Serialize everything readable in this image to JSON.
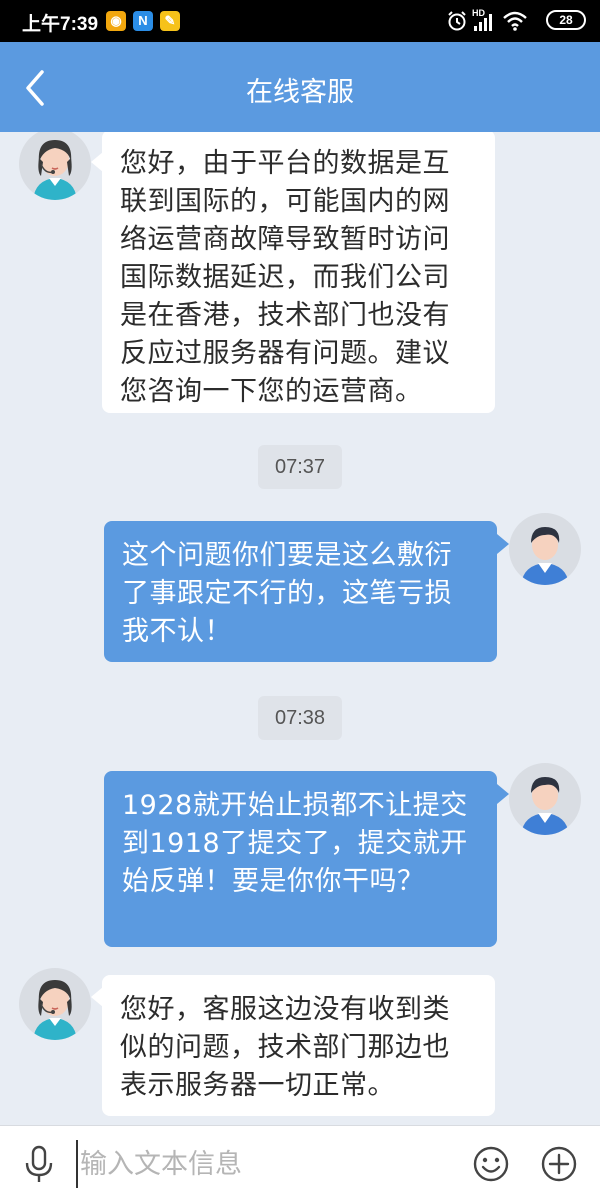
{
  "status_bar": {
    "time": "上午7:39",
    "network": "HD",
    "battery": "28"
  },
  "header": {
    "title": "在线客服"
  },
  "messages": [
    {
      "sender": "agent",
      "text": "您好，由于平台的数据是互联到国际的，可能国内的网络运营商故障导致暂时访问国际数据延迟，而我们公司是在香港，技术部门也没有反应过服务器有问题。建议您咨询一下您的运营商。"
    },
    {
      "type": "timestamp",
      "text": "07:37"
    },
    {
      "sender": "user",
      "text": "这个问题你们要是这么敷衍了事跟定不行的，这笔亏损我不认！"
    },
    {
      "type": "timestamp",
      "text": "07:38"
    },
    {
      "sender": "user",
      "text": "1928就开始止损都不让提交到1918了提交了，提交就开始反弹！要是你你干吗？"
    },
    {
      "sender": "agent",
      "text": "您好，客服这边没有收到类似的问题，技术部门那边也表示服务器一切正常。"
    }
  ],
  "input": {
    "placeholder": "输入文本信息",
    "value": ""
  },
  "icons": {
    "back": "chevron-left-icon",
    "mic": "microphone-icon",
    "emoji": "smiley-icon",
    "plus": "plus-circle-icon"
  },
  "colors": {
    "header_bg": "#5b9ae0",
    "user_bubble": "#5b9ae0",
    "agent_bubble": "#ffffff",
    "chat_bg": "#e8edf4"
  }
}
